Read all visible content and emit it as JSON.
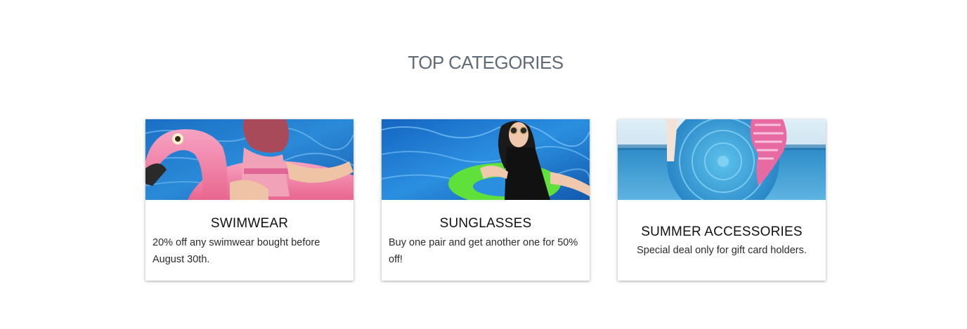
{
  "section": {
    "title": "TOP CATEGORIES"
  },
  "categories": [
    {
      "title": "SWIMWEAR",
      "description": "20% off any swimwear bought before August 30th.",
      "image_icon": "flamingo-float-photo"
    },
    {
      "title": "SUNGLASSES",
      "description": "Buy one pair and get another one for 50% off!",
      "image_icon": "pool-sunglasses-photo"
    },
    {
      "title": "SUMMER ACCESSORIES",
      "description": "Special deal only for gift card holders.",
      "image_icon": "beach-bag-photo"
    }
  ],
  "colors": {
    "title": "#5f6b77",
    "pool_blue": "#1d74c9",
    "flamingo_pink": "#f07aa6",
    "float_green": "#62e03a",
    "sea_blue": "#3b9bd0"
  }
}
